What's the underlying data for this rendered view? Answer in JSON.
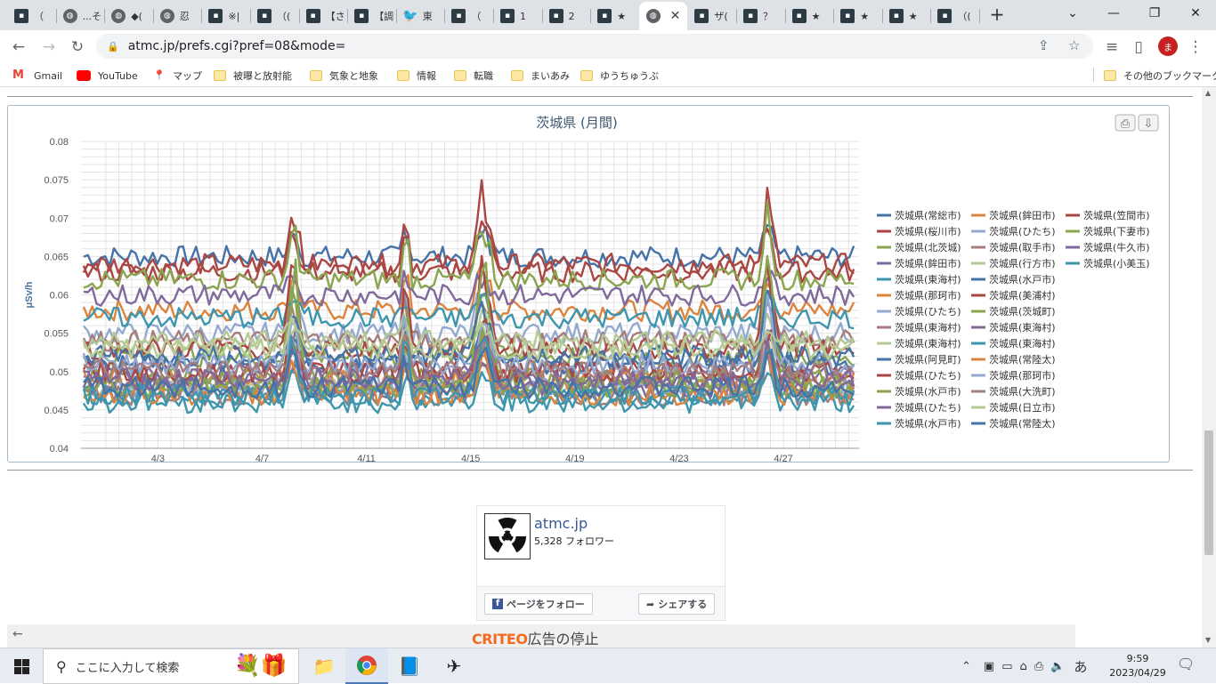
{
  "browser": {
    "tabs": [
      {
        "label": "（",
        "icon": "site-icon"
      },
      {
        "label": "...そ",
        "icon": "globe-icon"
      },
      {
        "label": "◆(",
        "icon": "globe-icon"
      },
      {
        "label": "忍",
        "icon": "globe-icon"
      },
      {
        "label": "※|",
        "icon": "site-icon"
      },
      {
        "label": "（(",
        "icon": "site-icon"
      },
      {
        "label": "【さ",
        "icon": "site-icon"
      },
      {
        "label": "【調",
        "icon": "site-icon"
      },
      {
        "label": "東",
        "icon": "twitter-bird-icon"
      },
      {
        "label": "（",
        "icon": "site-icon"
      },
      {
        "label": "1",
        "icon": "site-icon"
      },
      {
        "label": "2",
        "icon": "site-icon"
      },
      {
        "label": "★",
        "icon": "site-icon"
      },
      {
        "label": "",
        "icon": "globe-icon",
        "active": true
      },
      {
        "label": "ザ(",
        "icon": "site-icon"
      },
      {
        "label": "？",
        "icon": "site-icon"
      },
      {
        "label": "★",
        "icon": "site-icon"
      },
      {
        "label": "★",
        "icon": "site-icon"
      },
      {
        "label": "★",
        "icon": "site-icon"
      },
      {
        "label": "（(",
        "icon": "site-icon"
      }
    ],
    "url": "atmc.jp/prefs.cgi?pref=08&mode=",
    "avatar_initial": "ま",
    "bookmarks": [
      {
        "label": "Gmail",
        "icon": "gmail-icon"
      },
      {
        "label": "YouTube",
        "icon": "youtube-icon"
      },
      {
        "label": "マップ",
        "icon": "maps-pin-icon"
      },
      {
        "label": "被曝と放射能",
        "icon": "folder-icon"
      },
      {
        "label": "気象と地象",
        "icon": "folder-icon"
      },
      {
        "label": "情報",
        "icon": "folder-icon"
      },
      {
        "label": "転職",
        "icon": "folder-icon"
      },
      {
        "label": "まいあみ",
        "icon": "folder-icon"
      },
      {
        "label": "ゆうちゅうぶ",
        "icon": "folder-icon"
      }
    ],
    "other_bookmarks": "その他のブックマーク"
  },
  "chart_data": {
    "type": "line",
    "title": "茨城県 (月間)",
    "ylabel": "μSv/h",
    "ylim": [
      0.04,
      0.08
    ],
    "yticks": [
      "0.08",
      "0.075",
      "0.07",
      "0.065",
      "0.06",
      "0.055",
      "0.05",
      "0.045",
      "0.04"
    ],
    "xlabels": [
      {
        "label": "4/3",
        "day": 3
      },
      {
        "label": "4/7",
        "day": 7
      },
      {
        "label": "4/11",
        "day": 11
      },
      {
        "label": "4/15",
        "day": 15
      },
      {
        "label": "4/19",
        "day": 19
      },
      {
        "label": "4/23",
        "day": 23
      },
      {
        "label": "4/27",
        "day": 27
      }
    ],
    "xlim_days": [
      0.05,
      29.9
    ],
    "spikes": [
      {
        "day": 8.2,
        "width": 0.35
      },
      {
        "day": 12.5,
        "width": 0.2
      },
      {
        "day": 15.5,
        "width": 0.5
      },
      {
        "day": 26.4,
        "width": 0.4
      }
    ],
    "series": [
      {
        "name": "茨城県(常総市)",
        "color": "#4572A7",
        "base": 0.065,
        "peak": 0.07
      },
      {
        "name": "茨城県(鉾田市)",
        "color": "#DB843D",
        "base": 0.058,
        "peak": 0.066
      },
      {
        "name": "茨城県(笠間市)",
        "color": "#AA4643",
        "base": 0.064,
        "peak": 0.076
      },
      {
        "name": "茨城県(桜川市)",
        "color": "#AA4643",
        "base": 0.063,
        "peak": 0.072
      },
      {
        "name": "茨城県(ひたち)",
        "color": "#93A9CF",
        "base": 0.055,
        "peak": 0.063
      },
      {
        "name": "茨城県(下妻市)",
        "color": "#89A54E",
        "base": 0.062,
        "peak": 0.072
      },
      {
        "name": "茨城県(北茨城)",
        "color": "#89A54E",
        "base": 0.052,
        "peak": 0.067
      },
      {
        "name": "茨城県(取手市)",
        "color": "#A47D7C",
        "base": 0.054,
        "peak": 0.062
      },
      {
        "name": "茨城県(牛久市)",
        "color": "#80699B",
        "base": 0.06,
        "peak": 0.064
      },
      {
        "name": "茨城県(鉾田市)",
        "color": "#80699B",
        "base": 0.05,
        "peak": 0.058
      },
      {
        "name": "茨城県(行方市)",
        "color": "#B5CA92",
        "base": 0.048,
        "peak": 0.06
      },
      {
        "name": "茨城県(小美玉)",
        "color": "#3D96AE",
        "base": 0.057,
        "peak": 0.061
      },
      {
        "name": "茨城県(東海村)",
        "color": "#3D96AE",
        "base": 0.047,
        "peak": 0.056
      },
      {
        "name": "茨城県(水戸市)",
        "color": "#4572A7",
        "base": 0.051,
        "peak": 0.058
      },
      {
        "name": "茨城県(那珂市)",
        "color": "#DB843D",
        "base": 0.049,
        "peak": 0.057
      },
      {
        "name": "茨城県(美浦村)",
        "color": "#AA4643",
        "base": 0.053,
        "peak": 0.069
      },
      {
        "name": "茨城県(ひたち)",
        "color": "#93A9CF",
        "base": 0.048,
        "peak": 0.055
      },
      {
        "name": "茨城県(茨城町)",
        "color": "#89A54E",
        "base": 0.049,
        "peak": 0.07
      },
      {
        "name": "茨城県(東海村)",
        "color": "#A47D7C",
        "base": 0.047,
        "peak": 0.054
      },
      {
        "name": "茨城県(東海村)",
        "color": "#80699B",
        "base": 0.048,
        "peak": 0.053
      },
      {
        "name": "茨城県(東海村)",
        "color": "#B5CA92",
        "base": 0.054,
        "peak": 0.06
      },
      {
        "name": "茨城県(東海村)",
        "color": "#3D96AE",
        "base": 0.046,
        "peak": 0.052
      },
      {
        "name": "茨城県(阿見町)",
        "color": "#4572A7",
        "base": 0.052,
        "peak": 0.062
      },
      {
        "name": "茨城県(常陸太)",
        "color": "#DB843D",
        "base": 0.047,
        "peak": 0.054
      },
      {
        "name": "茨城県(ひたち)",
        "color": "#AA4643",
        "base": 0.05,
        "peak": 0.058
      },
      {
        "name": "茨城県(那珂市)",
        "color": "#93A9CF",
        "base": 0.051,
        "peak": 0.06
      },
      {
        "name": "茨城県(水戸市)",
        "color": "#89A54E",
        "base": 0.048,
        "peak": 0.056
      },
      {
        "name": "茨城県(大洗町)",
        "color": "#A47D7C",
        "base": 0.05,
        "peak": 0.057
      },
      {
        "name": "茨城県(ひたち)",
        "color": "#80699B",
        "base": 0.049,
        "peak": 0.055
      },
      {
        "name": "茨城県(日立市)",
        "color": "#B5CA92",
        "base": 0.053,
        "peak": 0.058
      },
      {
        "name": "茨城県(水戸市)",
        "color": "#3D96AE",
        "base": 0.047,
        "peak": 0.058
      },
      {
        "name": "茨城県(常陸太)",
        "color": "#4572A7",
        "base": 0.048,
        "peak": 0.054
      }
    ]
  },
  "fb": {
    "name": "atmc.jp",
    "followers": "5,328 フォロワー",
    "follow_label": "ページをフォロー",
    "share_label": "シェアする"
  },
  "ad": {
    "brand": "CRITEO",
    "text": "広告の停止"
  },
  "taskbar": {
    "search_placeholder": "ここに入力して検索",
    "ime": "あ",
    "time": "9:59",
    "date": "2023/04/29"
  }
}
